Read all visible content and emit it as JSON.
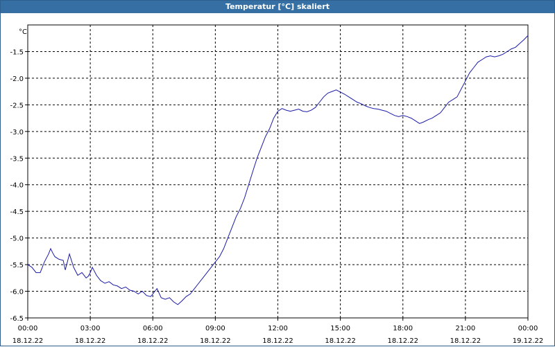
{
  "window": {
    "title": "Temperatur [°C] skaliert"
  },
  "chart_data": {
    "type": "line",
    "title": "Temperatur [°C] skaliert",
    "ylabel": "°C",
    "xlabel": "",
    "ylim": [
      -6.5,
      -1.0
    ],
    "xlim": [
      0,
      24
    ],
    "grid": true,
    "y_ticks": [
      "-1.5",
      "-2.0",
      "-2.5",
      "-3.0",
      "-3.5",
      "-4.0",
      "-4.5",
      "-5.0",
      "-5.5",
      "-6.0",
      "-6.5"
    ],
    "x_ticks": [
      {
        "time": "00:00",
        "date": "18.12.22"
      },
      {
        "time": "03:00",
        "date": "18.12.22"
      },
      {
        "time": "06:00",
        "date": "18.12.22"
      },
      {
        "time": "09:00",
        "date": "18.12.22"
      },
      {
        "time": "12:00",
        "date": "18.12.22"
      },
      {
        "time": "15:00",
        "date": "18.12.22"
      },
      {
        "time": "18:00",
        "date": "18.12.22"
      },
      {
        "time": "21:00",
        "date": "18.12.22"
      },
      {
        "time": "00:00",
        "date": "19.12.22"
      }
    ],
    "series": [
      {
        "color": "#1a1aa8",
        "x": [
          0.0,
          0.2,
          0.4,
          0.6,
          0.8,
          1.0,
          1.1,
          1.2,
          1.3,
          1.5,
          1.7,
          1.8,
          1.9,
          2.0,
          2.2,
          2.4,
          2.6,
          2.8,
          2.9,
          3.0,
          3.1,
          3.3,
          3.5,
          3.7,
          3.9,
          4.1,
          4.3,
          4.5,
          4.7,
          4.9,
          5.1,
          5.3,
          5.5,
          5.7,
          5.9,
          6.0,
          6.1,
          6.2,
          6.4,
          6.6,
          6.8,
          7.0,
          7.2,
          7.4,
          7.6,
          7.8,
          8.0,
          8.2,
          8.4,
          8.6,
          8.8,
          9.0,
          9.2,
          9.4,
          9.6,
          9.8,
          10.0,
          10.2,
          10.4,
          10.6,
          10.8,
          11.0,
          11.2,
          11.4,
          11.6,
          11.8,
          12.0,
          12.2,
          12.4,
          12.6,
          12.8,
          13.0,
          13.2,
          13.4,
          13.6,
          13.8,
          14.0,
          14.2,
          14.4,
          14.6,
          14.8,
          15.0,
          15.2,
          15.4,
          15.6,
          15.8,
          16.0,
          16.2,
          16.4,
          16.6,
          16.8,
          17.0,
          17.2,
          17.4,
          17.6,
          17.8,
          18.0,
          18.2,
          18.4,
          18.6,
          18.8,
          19.0,
          19.2,
          19.4,
          19.6,
          19.8,
          20.0,
          20.2,
          20.4,
          20.6,
          20.8,
          21.0,
          21.2,
          21.4,
          21.6,
          21.8,
          22.0,
          22.2,
          22.4,
          22.6,
          22.8,
          23.0,
          23.2,
          23.4,
          23.6,
          23.8,
          24.0
        ],
        "y": [
          -5.5,
          -5.55,
          -5.65,
          -5.65,
          -5.45,
          -5.3,
          -5.2,
          -5.28,
          -5.35,
          -5.4,
          -5.42,
          -5.6,
          -5.45,
          -5.3,
          -5.55,
          -5.7,
          -5.65,
          -5.75,
          -5.72,
          -5.65,
          -5.55,
          -5.7,
          -5.8,
          -5.85,
          -5.82,
          -5.88,
          -5.9,
          -5.95,
          -5.92,
          -5.98,
          -6.0,
          -6.05,
          -6.0,
          -6.08,
          -6.1,
          -6.05,
          -6.0,
          -5.95,
          -6.12,
          -6.15,
          -6.12,
          -6.2,
          -6.25,
          -6.18,
          -6.1,
          -6.05,
          -5.95,
          -5.85,
          -5.75,
          -5.65,
          -5.55,
          -5.45,
          -5.35,
          -5.2,
          -5.0,
          -4.8,
          -4.6,
          -4.45,
          -4.25,
          -4.0,
          -3.75,
          -3.5,
          -3.3,
          -3.1,
          -2.95,
          -2.75,
          -2.62,
          -2.57,
          -2.6,
          -2.62,
          -2.6,
          -2.58,
          -2.62,
          -2.63,
          -2.6,
          -2.55,
          -2.45,
          -2.35,
          -2.28,
          -2.25,
          -2.22,
          -2.26,
          -2.3,
          -2.35,
          -2.4,
          -2.45,
          -2.48,
          -2.52,
          -2.55,
          -2.57,
          -2.58,
          -2.6,
          -2.62,
          -2.66,
          -2.7,
          -2.72,
          -2.7,
          -2.72,
          -2.75,
          -2.8,
          -2.85,
          -2.82,
          -2.78,
          -2.75,
          -2.7,
          -2.65,
          -2.55,
          -2.45,
          -2.4,
          -2.35,
          -2.2,
          -2.05,
          -1.9,
          -1.8,
          -1.7,
          -1.65,
          -1.6,
          -1.58,
          -1.6,
          -1.58,
          -1.55,
          -1.5,
          -1.45,
          -1.42,
          -1.35,
          -1.28,
          -1.2
        ]
      }
    ]
  }
}
